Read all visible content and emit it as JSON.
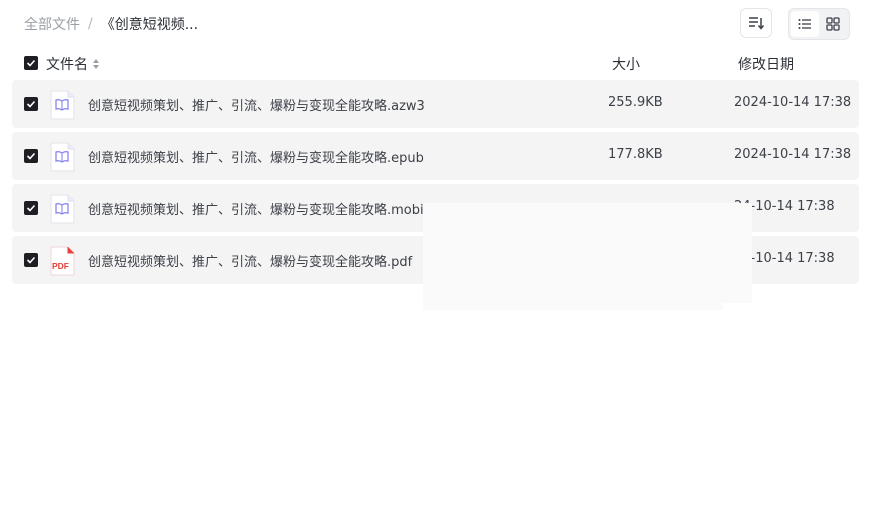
{
  "breadcrumb": {
    "root": "全部文件",
    "separator": "/",
    "current": "《创意短视频..."
  },
  "toolbar": {
    "sort_icon": "sort-lines-icon",
    "list_view_icon": "list-view-icon",
    "grid_view_icon": "grid-view-icon"
  },
  "columns": {
    "name": "文件名",
    "size": "大小",
    "date": "修改日期"
  },
  "files": [
    {
      "name": "创意短视频策划、推广、引流、爆粉与变现全能攻略.azw3",
      "size": "255.9KB",
      "date": "2024-10-14 17:38",
      "type": "ebook"
    },
    {
      "name": "创意短视频策划、推广、引流、爆粉与变现全能攻略.epub",
      "size": "177.8KB",
      "date": "2024-10-14 17:38",
      "type": "ebook"
    },
    {
      "name": "创意短视频策划、推广、引流、爆粉与变现全能攻略.mobi",
      "size": "",
      "date": "24-10-14 17:38",
      "type": "ebook"
    },
    {
      "name": "创意短视频策划、推广、引流、爆粉与变现全能攻略.pdf",
      "size": "",
      "date": "24-10-14 17:38",
      "type": "pdf"
    }
  ],
  "pdf_icon_label": "PDF",
  "colors": {
    "row_bg": "#f4f4f5",
    "ebook_icon": "#8a86f0",
    "pdf_icon": "#e8403a",
    "checkbox": "#1d1f23"
  }
}
